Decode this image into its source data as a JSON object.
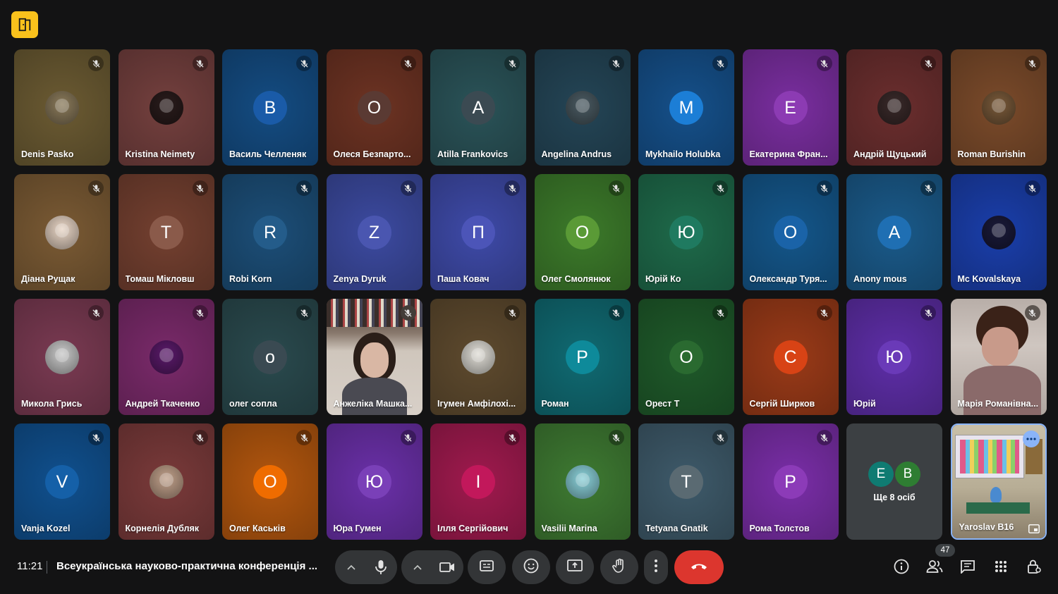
{
  "app": {
    "logo_icon": "door-exit-icon"
  },
  "participants": [
    {
      "name": "Denis Pasko",
      "avatar": "photo",
      "bg": "#6b5a32",
      "av": "#8a7a5a"
    },
    {
      "name": "Kristina Neimety",
      "avatar": "photo",
      "bg": "#74403e",
      "av": "#2a1c1c"
    },
    {
      "name": "Василь Челленяк",
      "avatar": "В",
      "bg": "#144c82",
      "av": "#1a5ba8"
    },
    {
      "name": "Олеся Безпарто...",
      "avatar": "О",
      "bg": "#6d3323",
      "av": "#5a3a33"
    },
    {
      "name": "Atilla Frankovics",
      "avatar": "A",
      "bg": "#2a5358",
      "av": "#3b4a52"
    },
    {
      "name": "Angelina Andrus",
      "avatar": "photo",
      "bg": "#244556",
      "av": "#4a5a62"
    },
    {
      "name": "Mykhailo Holubka",
      "avatar": "M",
      "bg": "#15508a",
      "av": "#1c7ed6"
    },
    {
      "name": "Екатерина Фран...",
      "avatar": "E",
      "bg": "#7a2ea0",
      "av": "#8c3bb3"
    },
    {
      "name": "Андрій Щуцький",
      "avatar": "photo",
      "bg": "#6b2e2e",
      "av": "#3a2a2a"
    },
    {
      "name": "Roman Burishin",
      "avatar": "photo",
      "bg": "#7a4a2a",
      "av": "#7a5a3a"
    },
    {
      "name": "Діана Рущак",
      "avatar": "photo",
      "bg": "#7a5a34",
      "av": "#e8d5c5"
    },
    {
      "name": "Томаш Мікловш",
      "avatar": "T",
      "bg": "#744030",
      "av": "#8a5a4a"
    },
    {
      "name": "Robi Korn",
      "avatar": "R",
      "bg": "#1c4e78",
      "av": "#245c8a"
    },
    {
      "name": "Zenya Dyruk",
      "avatar": "Z",
      "bg": "#3c4aa0",
      "av": "#4a56b0"
    },
    {
      "name": "Паша Ковач",
      "avatar": "П",
      "bg": "#3e4aa8",
      "av": "#4c55b8"
    },
    {
      "name": "Олег Смолянюк",
      "avatar": "О",
      "bg": "#3c7a2a",
      "av": "#5a9a36"
    },
    {
      "name": "Юрій Ко",
      "avatar": "Ю",
      "bg": "#1e6a4a",
      "av": "#1f7a60"
    },
    {
      "name": "Олександр Туря...",
      "avatar": "О",
      "bg": "#14568a",
      "av": "#1a63a8"
    },
    {
      "name": "Anony mous",
      "avatar": "A",
      "bg": "#1a5a8a",
      "av": "#1f6fb3"
    },
    {
      "name": "Mc Kovalskaya",
      "avatar": "photo",
      "bg": "#1a3eaa",
      "av": "#1a1a3a"
    },
    {
      "name": "Микола Грись",
      "avatar": "photo",
      "bg": "#7a3a52",
      "av": "#c8c8c8"
    },
    {
      "name": "Андрей Ткаченко",
      "avatar": "photo",
      "bg": "#7a2a6a",
      "av": "#5a1a6a"
    },
    {
      "name": "олег сопла",
      "avatar": "о",
      "bg": "#2a4a4e",
      "av": "#3a4a52"
    },
    {
      "name": "Анжеліка Машка...",
      "avatar": "video",
      "bg": "#7a6e66",
      "av": "#7a6e66"
    },
    {
      "name": "Ігумен Амфілохі...",
      "avatar": "photo",
      "bg": "#5e4a2e",
      "av": "#e0ddd6"
    },
    {
      "name": "Роман",
      "avatar": "Р",
      "bg": "#106a72",
      "av": "#0e8a9a"
    },
    {
      "name": "Орест Т",
      "avatar": "О",
      "bg": "#1f5a2a",
      "av": "#2a6a30"
    },
    {
      "name": "Сергій Ширков",
      "avatar": "С",
      "bg": "#9a3a18",
      "av": "#d84315"
    },
    {
      "name": "Юрій",
      "avatar": "Ю",
      "bg": "#5e2ea8",
      "av": "#6a3ab8"
    },
    {
      "name": "Марія Романівна...",
      "avatar": "video",
      "bg": "#a89a92",
      "av": "#a89a92"
    },
    {
      "name": "Vanja Kozel",
      "avatar": "V",
      "bg": "#10508e",
      "av": "#1560a8"
    },
    {
      "name": "Корнелія Дубляк",
      "avatar": "photo",
      "bg": "#7a3a3a",
      "av": "#c0a08a"
    },
    {
      "name": "Олег Каськів",
      "avatar": "О",
      "bg": "#b2560e",
      "av": "#ef6c00"
    },
    {
      "name": "Юра Гумен",
      "avatar": "Ю",
      "bg": "#6a30a8",
      "av": "#7a40b8"
    },
    {
      "name": "Ілля Сергійович",
      "avatar": "І",
      "bg": "#a01a4e",
      "av": "#c2185b"
    },
    {
      "name": "Vasilii Marina",
      "avatar": "photo",
      "bg": "#3e7a32",
      "av": "#8ad0d8"
    },
    {
      "name": "Tetyana Gnatik",
      "avatar": "T",
      "bg": "#3e5a6a",
      "av": "#5a6a72"
    },
    {
      "name": "Рома Толстов",
      "avatar": "Р",
      "bg": "#7a2ea8",
      "av": "#8c3bb8"
    }
  ],
  "more": {
    "avatars": [
      {
        "letter": "Е",
        "color": "#0f7b72"
      },
      {
        "letter": "В",
        "color": "#2e7d32"
      }
    ],
    "label": "Ще 8 осіб"
  },
  "self": {
    "name": "Yaroslav B16",
    "options_icon": "more-horizontal-icon",
    "pip_icon": "picture-in-picture-icon"
  },
  "mic_icon": "mic-off-icon",
  "bottom": {
    "time": "11:21",
    "meeting_title": "Всеукраїнська науково-практична конференція ...",
    "participants_count": "47"
  },
  "colors": {
    "end_call": "#dc362e",
    "logo": "#f9c11c",
    "self_border": "#8ab4f8"
  }
}
